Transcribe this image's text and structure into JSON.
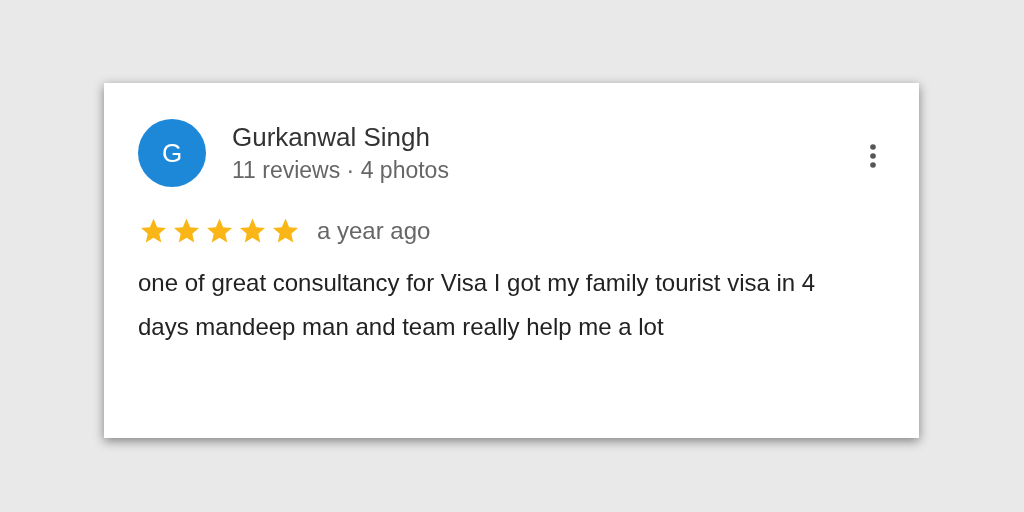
{
  "review": {
    "avatar_letter": "G",
    "author": "Gurkanwal Singh",
    "meta": "11 reviews · 4 photos",
    "stars": 5,
    "time": "a year ago",
    "text": "one of great consultancy for Visa I got my family tourist visa in 4 days mandeep man and team really help me a lot"
  }
}
